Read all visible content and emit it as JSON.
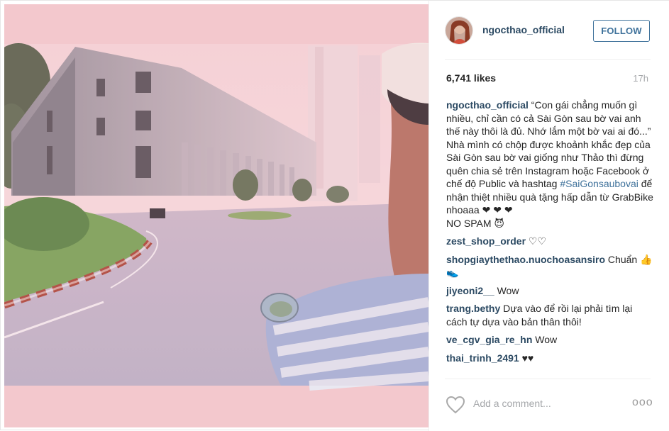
{
  "post": {
    "username": "ngocthao_official",
    "follow_label": "FOLLOW",
    "likes": "6,741 likes",
    "time": "17h"
  },
  "caption": {
    "username": "ngocthao_official",
    "lines": [
      " “Con gái chẳng muốn gì nhiều, chỉ cần có cả Sài Gòn sau bờ vai anh thế này thôi là đủ. Nhớ lắm một bờ vai ai đó...”",
      "Nhà mình có chộp được khoảnh khắc đẹp của Sài Gòn sau bờ vai giống như Thảo thì đừng quên chia sẻ trên Instagram hoặc Facebook ở chế độ Public và hashtag "
    ],
    "hashtag": "#SaiGonsaubovai",
    "tail": " để nhận thiệt nhiều quà tặng hấp dẫn từ GrabBike nhoaaa ❤ ❤ ❤",
    "last": "NO SPAM 😈"
  },
  "comments": [
    {
      "user": "zest_shop_order",
      "text": " ♡♡"
    },
    {
      "user": "shopgiaythethao.nuochoasansiro",
      "text": " Chuẩn 👍👟"
    },
    {
      "user": "jiyeoni2__",
      "text": " Wow"
    },
    {
      "user": "trang.bethy",
      "text": " Dựa vào để rồi lại phải tìm lại cách tự dựa vào bản thân thôi!"
    },
    {
      "user": "ve_cgv_gia_re_hn",
      "text": " Wow"
    },
    {
      "user": "thai_trinh_2491",
      "text": " ♥♥"
    }
  ],
  "footer": {
    "add_comment_placeholder": "Add a comment...",
    "more_label": "ooo"
  },
  "icons": {
    "like": "heart-outline-icon",
    "more": "more-options-icon"
  },
  "colors": {
    "username": "#2c4a63",
    "follow": "#3f729b",
    "muted": "#a5a7aa",
    "photo_tint": "#f3c8cd"
  }
}
